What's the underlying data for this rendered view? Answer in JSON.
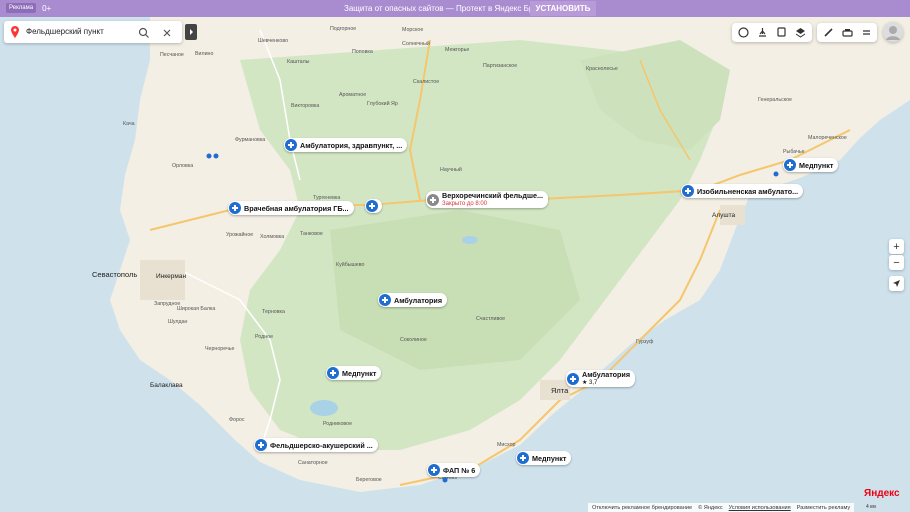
{
  "banner": {
    "ad_label": "Реклама",
    "age": "0+",
    "text": "Защита от опасных сайтов — Протект в Яндекс Браузере",
    "button": "УСТАНОВИТЬ"
  },
  "search": {
    "query": "Фельдшерский пункт",
    "icons": [
      "yandex-pin-icon",
      "search-icon",
      "close-icon",
      "collapse-arrow-icon"
    ]
  },
  "toolbar": {
    "icons": [
      "layers-traffic-icon",
      "panorama-icon",
      "transport-icon",
      "layers-icon",
      "ruler-icon",
      "print-icon",
      "menu-icon"
    ]
  },
  "zoom": {
    "plus": "+",
    "minus": "−"
  },
  "markers": [
    {
      "label": "Амбулатория, здравпункт, ..."
    },
    {
      "label": "Врачебная амбулатория ГБ..."
    },
    {
      "label": "Верхоречинский фельдше...",
      "sub": "Закрыто до 8:00"
    },
    {
      "label": "Медпункт"
    },
    {
      "label": "Изобильненская амбулато..."
    },
    {
      "label": "Амбулатория"
    },
    {
      "label": "Медпункт"
    },
    {
      "label": "Амбулатория",
      "sub": "★ 3,7"
    },
    {
      "label": "Фельдшерско-акушерский ..."
    },
    {
      "label": "ФАП № 6"
    },
    {
      "label": "Медпункт"
    }
  ],
  "cities": [
    "Севастополь",
    "Инкерман",
    "Балаклава",
    "Ялта",
    "Алушта"
  ],
  "places": [
    "Песчаное",
    "Вилино",
    "Шевченково",
    "Кача",
    "Орловка",
    "Фурмановка",
    "Кашталы",
    "Викторовка",
    "Ароматное",
    "Глубокий Яр",
    "Скалистое",
    "Партизанское",
    "Холмовка",
    "Танковое",
    "Тургеневка",
    "Научный",
    "Куйбышево",
    "Терновка",
    "Родное",
    "Черноречье",
    "Родниковое",
    "Форос",
    "Счастливое",
    "Соколиное",
    "Краснолесье",
    "Генеральское",
    "Малореченское",
    "Рыбачье",
    "Гурзуф",
    "Береговое",
    "Симеиз",
    "Мисхор",
    "Санаторное",
    "Запрудное",
    "Широкая Балка",
    "Шулдан",
    "Солнечный",
    "Межгорье",
    "Подгорное",
    "Морское",
    "Поповка",
    "Урожайное"
  ],
  "bottom": {
    "disable_ads": "Отключить рекламное брендирование",
    "copyright": "© Яндекс",
    "terms": "Условия использования",
    "place_ad": "Разместить рекламу",
    "scale": "4 км"
  },
  "logo": "Яндекс",
  "colors": {
    "marker": "#1f6dd1",
    "banner": "#a98bcf",
    "forest": "#cfe3c0",
    "sea": "#cfe2ec",
    "land": "#f2efe6"
  }
}
